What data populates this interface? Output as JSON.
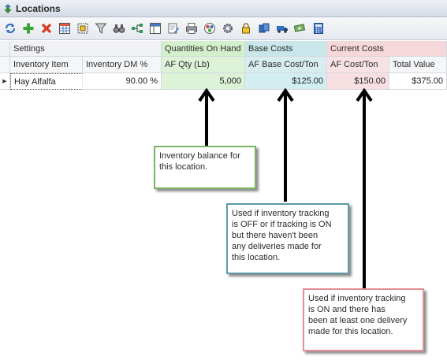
{
  "window": {
    "title": "Locations"
  },
  "toolbar": {
    "icons": [
      "refresh-icon",
      "add-icon",
      "delete-icon",
      "grid-icon",
      "select-all-icon",
      "filter-icon",
      "binoculars-icon",
      "tree-icon",
      "layout-icon",
      "edit-document-icon",
      "print-icon",
      "colors-icon",
      "gear-icon",
      "lock-icon",
      "users-icon",
      "truck-icon",
      "money-icon",
      "calculator-icon"
    ]
  },
  "grid": {
    "bands": {
      "settings": "Settings",
      "qty": "Quantities On Hand",
      "base": "Base Costs",
      "current": "Current Costs"
    },
    "columns": {
      "item": "Inventory Item",
      "dm": "Inventory DM %",
      "qty": "AF Qty (Lb)",
      "base_cost": "AF Base Cost/Ton",
      "af_cost": "AF Cost/Ton",
      "total": "Total Value"
    },
    "row": {
      "item": "Hay Alfalfa",
      "dm": "90.00 %",
      "qty": "5,000",
      "base_cost": "$125.00",
      "af_cost": "$150.00",
      "total": "$375.00"
    },
    "colors": {
      "qty": "#d3efcc",
      "base": "#c9e6ea",
      "current": "#f7d8da"
    }
  },
  "callouts": {
    "inventory": "Inventory balance for\nthis location.",
    "base": "Used if inventory tracking\nis OFF or if tracking is ON\nbut there haven't been\nany deliveries made for\nthis location.",
    "current": "Used if inventory tracking\nis ON and there has\nbeen at least one delivery\nmade for this location."
  }
}
